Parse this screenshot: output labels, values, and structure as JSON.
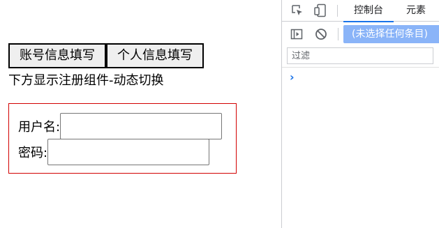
{
  "page": {
    "tabs": [
      {
        "label": "账号信息填写"
      },
      {
        "label": "个人信息填写"
      }
    ],
    "hint": "下方显示注册组件-动态切换",
    "form": {
      "username_label": "用户名:",
      "username_value": "",
      "password_label": "密码:",
      "password_value": ""
    }
  },
  "devtools": {
    "tabs": [
      {
        "label": "控制台",
        "active": true
      },
      {
        "label": "元素",
        "active": false
      }
    ],
    "context_selector": "(未选择任何条目)",
    "filter_placeholder": "过滤",
    "prompt_symbol": "›",
    "icons": [
      "inspect-element-icon",
      "device-toolbar-icon",
      "sidebar-toggle-icon",
      "clear-console-icon"
    ],
    "colors": {
      "accent": "#1a73e8",
      "context_selector_bg": "#8ab4f8",
      "form_border": "#d20000"
    }
  }
}
